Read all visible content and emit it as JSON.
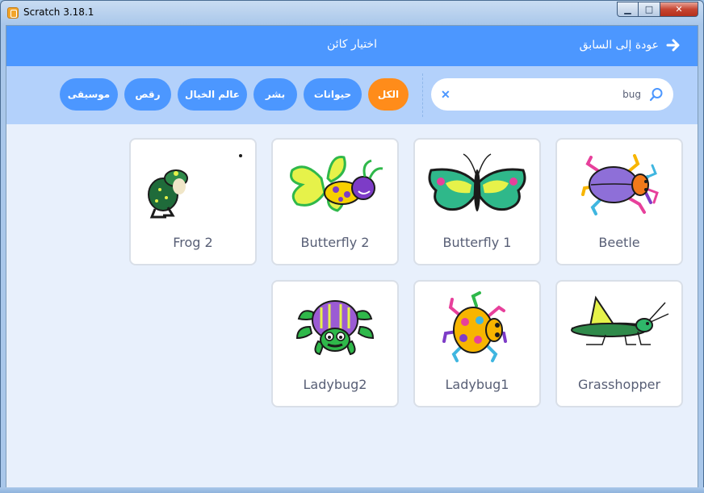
{
  "window": {
    "title": "Scratch 3.18.1",
    "controls": {
      "minimize": "▁",
      "maximize": "□",
      "close": "✕"
    }
  },
  "header": {
    "title": "اختيار كائن",
    "back_label": "عودة إلى السابق",
    "back_icon": "arrow-right-icon"
  },
  "search": {
    "value": "bug",
    "clear_glyph": "✕",
    "icon": "search-icon"
  },
  "tags": [
    {
      "label": "موسيقى",
      "active": false
    },
    {
      "label": "رقص",
      "active": false
    },
    {
      "label": "عالم الخيال",
      "active": false
    },
    {
      "label": "بشر",
      "active": false
    },
    {
      "label": "حيوانات",
      "active": false
    },
    {
      "label": "الكل",
      "active": true
    }
  ],
  "sprites": [
    {
      "label": "Beetle"
    },
    {
      "label": "Butterfly 1"
    },
    {
      "label": "Butterfly 2"
    },
    {
      "label": "Frog 2"
    },
    {
      "label": "Grasshopper"
    },
    {
      "label": "Ladybug1"
    },
    {
      "label": "Ladybug2"
    }
  ],
  "colors": {
    "header": "#4c97ff",
    "filterbar": "#b3d1fb",
    "active_tag": "#ff8c1a",
    "card_text": "#575e75"
  }
}
